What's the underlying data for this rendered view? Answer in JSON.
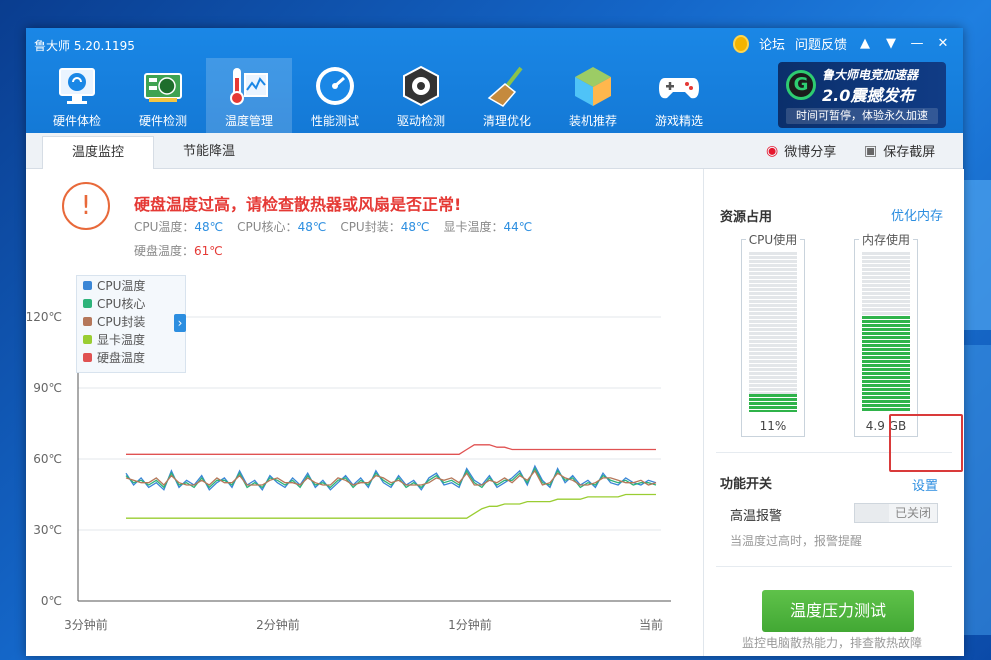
{
  "app": {
    "title": "鲁大师 5.20.1195"
  },
  "top_links": {
    "forum": "论坛",
    "feedback": "问题反馈"
  },
  "nav": [
    {
      "label": "硬件体检",
      "icon": "monitor-icon"
    },
    {
      "label": "硬件检测",
      "icon": "graphics-card-icon"
    },
    {
      "label": "温度管理",
      "icon": "thermometer-icon",
      "active": true
    },
    {
      "label": "性能测试",
      "icon": "speedometer-icon"
    },
    {
      "label": "驱动检测",
      "icon": "gear-box-icon"
    },
    {
      "label": "清理优化",
      "icon": "broom-icon"
    },
    {
      "label": "装机推荐",
      "icon": "cube-icon"
    },
    {
      "label": "游戏精选",
      "icon": "gamepad-icon"
    }
  ],
  "promo": {
    "line1": "鲁大师电竞加速器",
    "line2": "2.0震撼发布",
    "line3": "时间可暂停，体验永久加速"
  },
  "tabs": [
    {
      "label": "温度监控",
      "active": true
    },
    {
      "label": "节能降温"
    }
  ],
  "tab_actions": {
    "share": "微博分享",
    "screenshot": "保存截屏"
  },
  "alert": {
    "title": "硬盘温度过高，请检查散热器或风扇是否正常!",
    "cpu_temp_label": "CPU温度：",
    "cpu_temp": "48℃",
    "cpu_core_label": "CPU核心：",
    "cpu_core": "48℃",
    "cpu_pkg_label": "CPU封装：",
    "cpu_pkg": "48℃",
    "gpu_label": "显卡温度：",
    "gpu": "44℃",
    "disk_label": "硬盘温度：",
    "disk": "61℃"
  },
  "legend": [
    {
      "name": "CPU温度",
      "color": "#3a86d6"
    },
    {
      "name": "CPU核心",
      "color": "#2db37a"
    },
    {
      "name": "CPU封装",
      "color": "#b5775a"
    },
    {
      "name": "显卡温度",
      "color": "#9acd32"
    },
    {
      "name": "硬盘温度",
      "color": "#e05252"
    }
  ],
  "chart_data": {
    "type": "line",
    "ylim": [
      0,
      120
    ],
    "yticks": [
      "120℃",
      "90℃",
      "60℃",
      "30℃",
      "0℃"
    ],
    "ytick_values": [
      120,
      90,
      60,
      30,
      0
    ],
    "xticks": [
      "3分钟前",
      "2分钟前",
      "1分钟前",
      "当前"
    ],
    "grid": true,
    "series": [
      {
        "name": "CPU温度",
        "color": "#3a86d6",
        "values": [
          54,
          49,
          52,
          48,
          50,
          47,
          55,
          48,
          51,
          49,
          53,
          47,
          50,
          52,
          48,
          55,
          49,
          51,
          47,
          53,
          50,
          48,
          52,
          49,
          54,
          48,
          51,
          47,
          50,
          53,
          49,
          52,
          48,
          55,
          50,
          48,
          53,
          49,
          51,
          47,
          52,
          54,
          49,
          50,
          48,
          56,
          51,
          49,
          53,
          48,
          50,
          52,
          55,
          49,
          57,
          51,
          48,
          56,
          50,
          53,
          49,
          51,
          48,
          54,
          50,
          49,
          52,
          50,
          49,
          51,
          50
        ]
      },
      {
        "name": "CPU核心",
        "color": "#2db37a",
        "values": [
          53,
          50,
          51,
          49,
          51,
          48,
          54,
          49,
          50,
          48,
          52,
          48,
          51,
          51,
          49,
          54,
          48,
          50,
          48,
          52,
          51,
          49,
          51,
          48,
          53,
          49,
          50,
          48,
          51,
          52,
          48,
          51,
          49,
          54,
          51,
          49,
          52,
          48,
          50,
          48,
          51,
          53,
          50,
          51,
          49,
          55,
          50,
          48,
          52,
          49,
          51,
          51,
          54,
          50,
          56,
          50,
          49,
          55,
          51,
          52,
          48,
          50,
          49,
          53,
          51,
          50,
          51,
          49,
          50,
          50,
          49
        ]
      },
      {
        "name": "CPU封装",
        "color": "#b5775a",
        "values": [
          52,
          51,
          50,
          50,
          52,
          49,
          53,
          50,
          49,
          49,
          51,
          49,
          52,
          50,
          50,
          53,
          49,
          49,
          49,
          51,
          52,
          50,
          50,
          49,
          52,
          50,
          49,
          49,
          52,
          51,
          49,
          50,
          50,
          53,
          52,
          50,
          51,
          49,
          49,
          49,
          50,
          52,
          51,
          52,
          50,
          54,
          49,
          49,
          51,
          50,
          52,
          50,
          53,
          51,
          55,
          49,
          50,
          54,
          52,
          51,
          49,
          49,
          50,
          52,
          52,
          51,
          50,
          50,
          51,
          49,
          50
        ]
      },
      {
        "name": "显卡温度",
        "color": "#9acd32",
        "values": [
          35,
          35,
          35,
          35,
          35,
          35,
          35,
          35,
          35,
          35,
          35,
          35,
          35,
          35,
          35,
          35,
          35,
          35,
          35,
          35,
          35,
          35,
          35,
          35,
          35,
          35,
          35,
          35,
          35,
          35,
          35,
          35,
          35,
          35,
          35,
          35,
          35,
          35,
          35,
          35,
          35,
          35,
          35,
          35,
          35,
          35,
          37,
          39,
          40,
          40,
          41,
          41,
          41,
          42,
          42,
          42,
          42,
          43,
          43,
          43,
          43,
          44,
          44,
          44,
          44,
          44,
          45,
          45,
          45,
          45,
          45
        ]
      },
      {
        "name": "硬盘温度",
        "color": "#e05252",
        "values": [
          62,
          62,
          62,
          62,
          62,
          62,
          62,
          62,
          62,
          62,
          62,
          62,
          62,
          62,
          62,
          62,
          62,
          62,
          62,
          62,
          62,
          62,
          62,
          62,
          62,
          62,
          62,
          62,
          62,
          62,
          62,
          62,
          62,
          62,
          62,
          62,
          62,
          62,
          62,
          62,
          62,
          62,
          62,
          62,
          62,
          64,
          66,
          66,
          66,
          65,
          65,
          64,
          64,
          64,
          64,
          64,
          64,
          64,
          64,
          64,
          64,
          64,
          64,
          64,
          64,
          64,
          64,
          64,
          64,
          64,
          64
        ]
      }
    ]
  },
  "side": {
    "resources_title": "资源占用",
    "optimize": "优化内存",
    "cpu_label": "CPU使用",
    "cpu_value": "11%",
    "cpu_fraction": 0.11,
    "mem_label": "内存使用",
    "mem_value": "4.9 GB",
    "mem_fraction": 0.6,
    "func_title": "功能开关",
    "settings": "设置",
    "high_temp": "高温报警",
    "toggle_state": "已关闭",
    "hint": "当温度过高时，报警提醒",
    "stress_btn": "温度压力测试",
    "stress_hint": "监控电脑散热能力，排查散热故障"
  }
}
